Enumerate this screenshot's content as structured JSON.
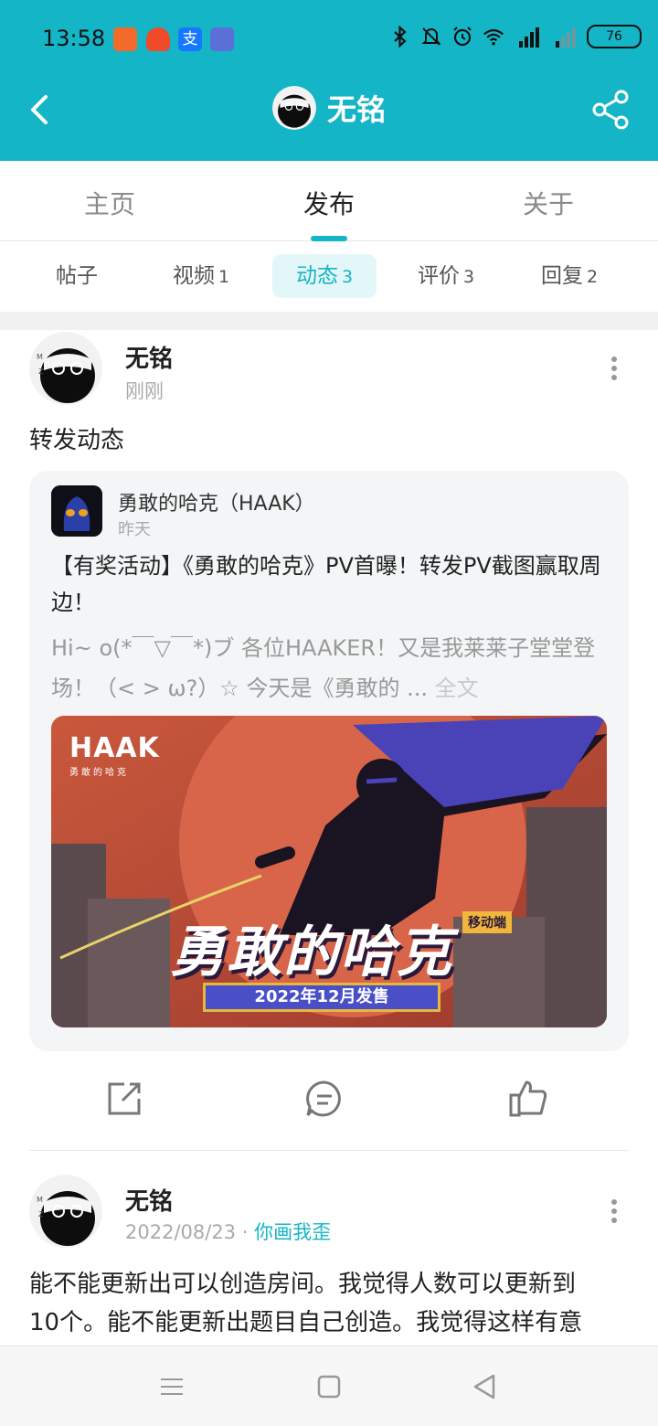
{
  "status": {
    "time": "13:58",
    "network": "4G",
    "battery": "76"
  },
  "header": {
    "title": "无铭",
    "accent": "#14b5c6"
  },
  "tabs": [
    {
      "label": "主页"
    },
    {
      "label": "发布"
    },
    {
      "label": "关于"
    }
  ],
  "subtabs": [
    {
      "label": "帖子",
      "count": ""
    },
    {
      "label": "视频",
      "count": "1"
    },
    {
      "label": "动态",
      "count": "3"
    },
    {
      "label": "评价",
      "count": "3"
    },
    {
      "label": "回复",
      "count": "2"
    }
  ],
  "post1": {
    "user": "无铭",
    "time": "刚刚",
    "text": "转发动态",
    "card": {
      "author": "勇敢的哈克（HAAK）",
      "date": "昨天",
      "title": "【有奖活动】《勇敢的哈克》PV首曝！转发PV截图赢取周边！",
      "excerpt": "Hi~ o(*￣▽￣*)ブ 各位HAAKER！又是我莱莱子堂堂登场！（< > ω?）☆ 今天是《勇敢的 ...",
      "more_label": "全文",
      "banner": {
        "brand": "HAAK",
        "brand_sub": "勇敢的哈克",
        "title": "勇敢的哈克",
        "badge": "移动端",
        "date": "2022年12月发售"
      }
    }
  },
  "post2": {
    "user": "无铭",
    "date": "2022/08/23",
    "topic": "你画我歪",
    "text_line1": "能不能更新出可以创造房间。我觉得人数可以更新到",
    "text_line2": "10个。能不能更新出题目自己创造。我觉得这样有意"
  }
}
